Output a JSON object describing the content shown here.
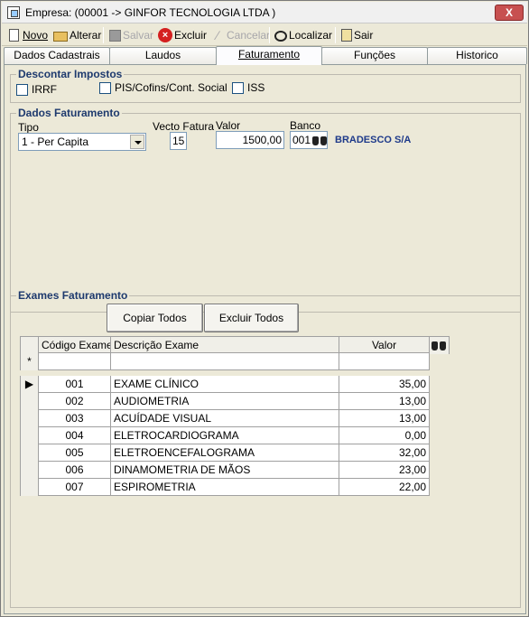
{
  "window": {
    "title": "Empresa: (00001 -> GINFOR TECNOLOGIA LTDA )",
    "close_label": "X"
  },
  "toolbar": {
    "novo": "Novo",
    "alterar": "Alterar",
    "salvar": "Salvar",
    "excluir": "Excluir",
    "cancelar": "Cancelar",
    "localizar": "Localizar",
    "sair": "Sair"
  },
  "tabs": [
    "Dados Cadastrais",
    "Laudos",
    "Faturamento",
    "Funções",
    "Historico"
  ],
  "active_tab": "Faturamento",
  "descontar_impostos": {
    "legend": "Descontar Impostos",
    "options": [
      "IRRF",
      "PIS/Cofins/Cont. Social",
      "ISS"
    ]
  },
  "dados_faturamento": {
    "legend": "Dados Faturamento",
    "tipo_label": "Tipo",
    "tipo_value": "1 - Per Capita",
    "vecto_label": "Vecto Fatura",
    "vecto_value": "15",
    "valor_label": "Valor",
    "valor_value": "1500,00",
    "banco_label": "Banco",
    "banco_code": "001",
    "banco_name": "BRADESCO S/A"
  },
  "exames_faturamento": {
    "legend": "Exames Faturamento",
    "copiar_label": "Copiar Todos",
    "excluir_label": "Excluir Todos",
    "new_row_marker": "*",
    "current_row_marker": "▶",
    "columns": [
      "Código Exame",
      "Descrição Exame",
      "Valor"
    ],
    "rows": [
      {
        "code": "001",
        "desc": "EXAME CLÍNICO",
        "valor": "35,00"
      },
      {
        "code": "002",
        "desc": "AUDIOMETRIA",
        "valor": "13,00"
      },
      {
        "code": "003",
        "desc": "ACUÍDADE VISUAL",
        "valor": "13,00"
      },
      {
        "code": "004",
        "desc": "ELETROCARDIOGRAMA",
        "valor": "0,00"
      },
      {
        "code": "005",
        "desc": "ELETROENCEFALOGRAMA",
        "valor": "32,00"
      },
      {
        "code": "006",
        "desc": "DINAMOMETRIA DE MÃOS",
        "valor": "23,00"
      },
      {
        "code": "007",
        "desc": "ESPIROMETRIA",
        "valor": "22,00"
      }
    ]
  },
  "colors": {
    "legend": "#1e3a6e",
    "bank_name": "#1e3a8a",
    "close_button": "#c75050"
  }
}
